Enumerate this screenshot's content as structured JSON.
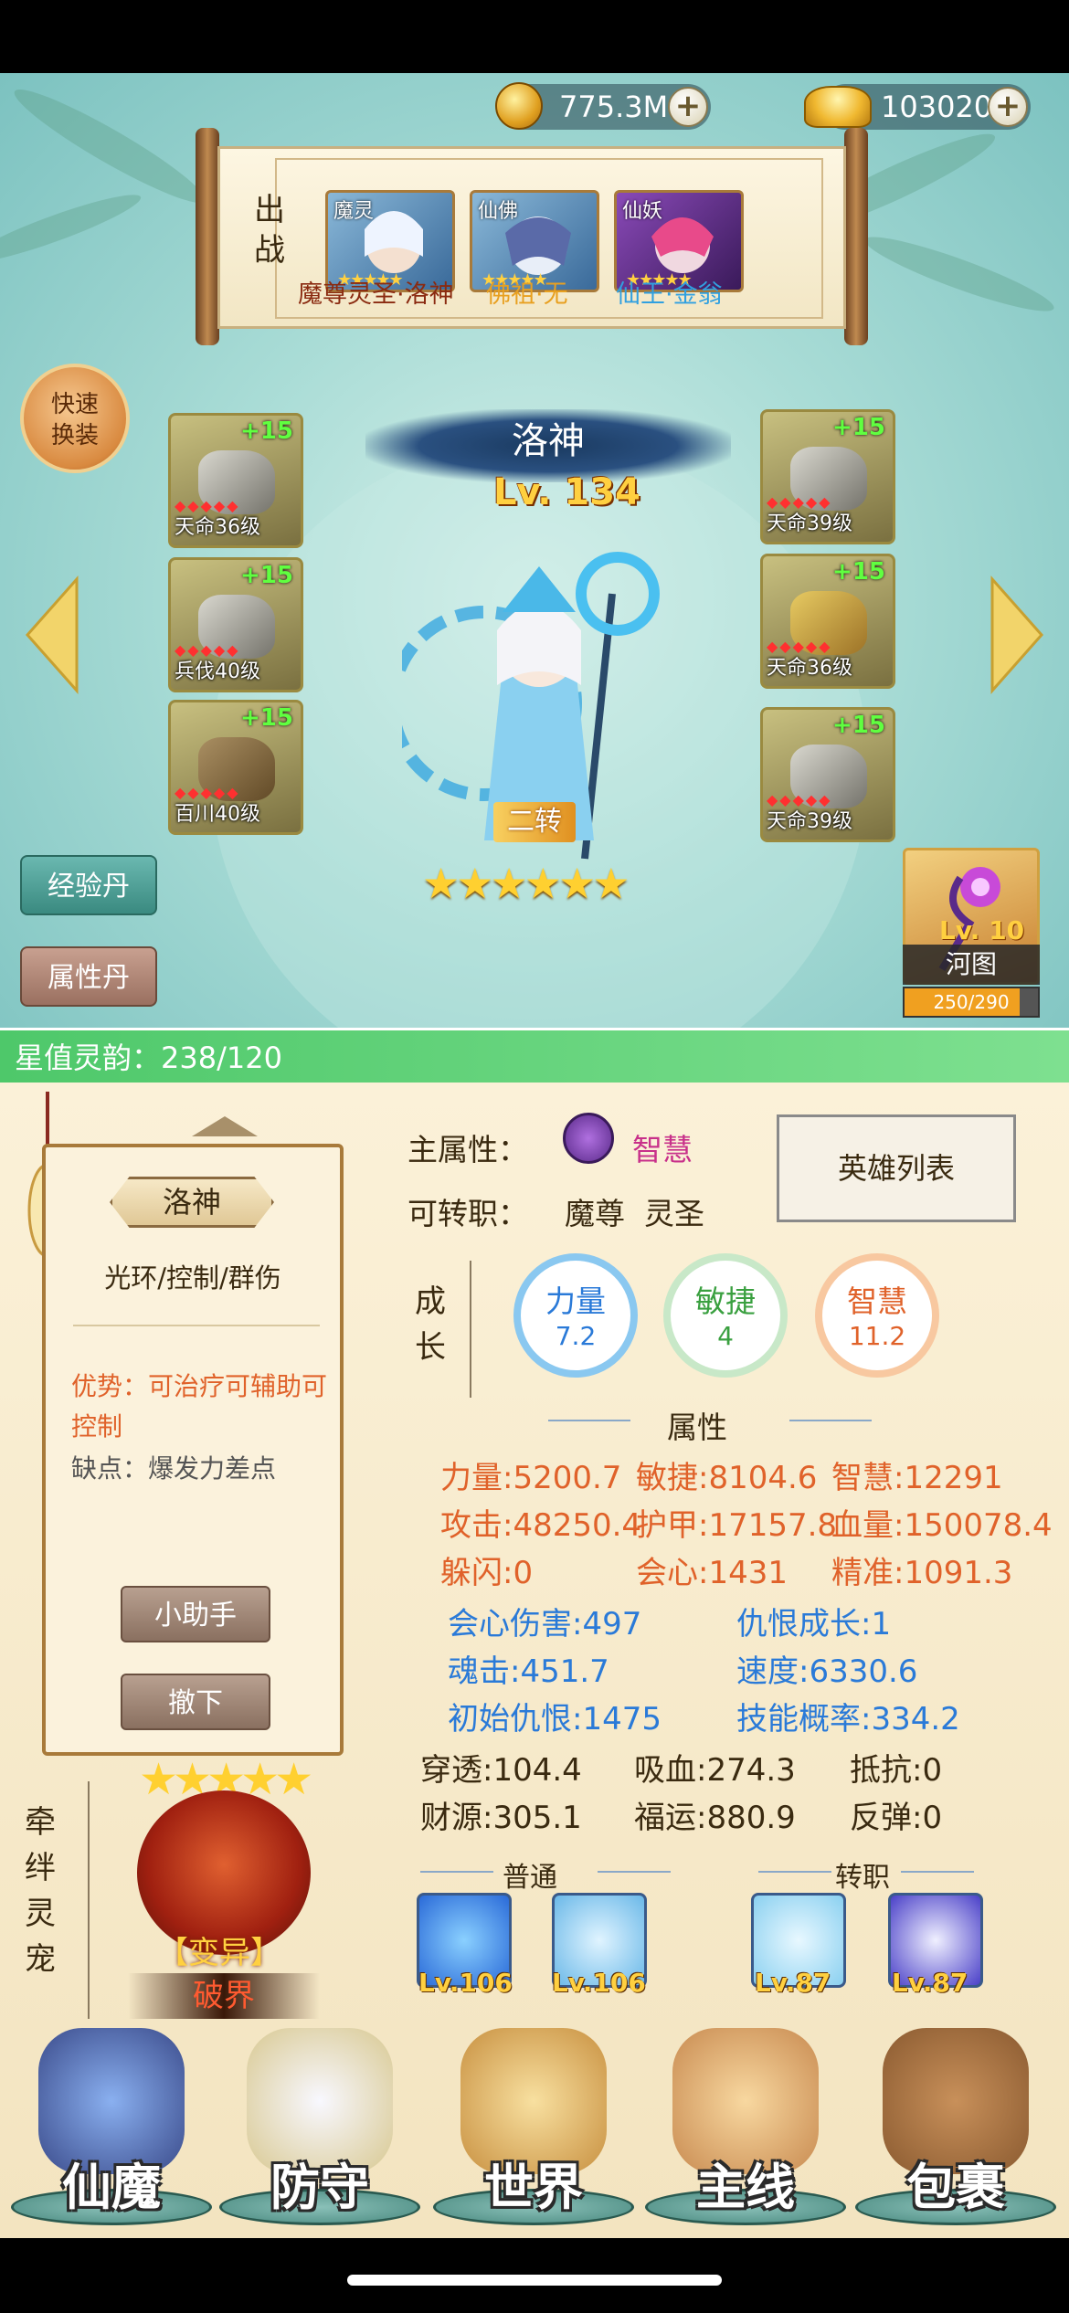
{
  "currency": {
    "coins": "775.3M",
    "ingots": "103020"
  },
  "team": {
    "label": "出战",
    "members": [
      {
        "tag": "魔灵",
        "name": "魔尊灵圣·洛神",
        "color": "#8a2a10",
        "stars": "★★★★★"
      },
      {
        "tag": "仙佛",
        "name": "佛祖·无",
        "color": "#e8a020",
        "stars": "★★★★★"
      },
      {
        "tag": "仙妖",
        "name": "仙王·金翁",
        "color": "#30a0e0",
        "stars": "★★★★★"
      }
    ]
  },
  "quick_swap": [
    "快速",
    "换装"
  ],
  "hero": {
    "name": "洛神",
    "level": "Lv. 134",
    "transfer": "二转",
    "stars": "★★★★★★"
  },
  "equipment_left": [
    {
      "plus": "+15",
      "level": "天命36级"
    },
    {
      "plus": "+15",
      "level": "兵伐40级"
    },
    {
      "plus": "+15",
      "level": "百川40级"
    }
  ],
  "equipment_right": [
    {
      "plus": "+15",
      "level": "天命39级"
    },
    {
      "plus": "+15",
      "level": "天命36级"
    },
    {
      "plus": "+15",
      "level": "天命39级"
    }
  ],
  "buttons": {
    "exp_pill": "经验丹",
    "attr_pill": "属性丹",
    "helper": "小助手",
    "withdraw": "撤下",
    "hero_list": "英雄列表"
  },
  "hetu": {
    "level": "Lv. 10",
    "label": "河图",
    "progress_text": "250/290",
    "progress": 0.862
  },
  "star_bar": "星值灵韵：238/120",
  "panel": {
    "name": "洛神",
    "tags": "光环/控制/群伤",
    "advantage": "优势：可治疗可辅助可控制",
    "disadvantage": "缺点：爆发力差点"
  },
  "main_attr": {
    "label": "主属性：",
    "value": "智慧",
    "job_label": "可转职：",
    "jobs": "魔尊  灵圣"
  },
  "growth": {
    "label": "成长",
    "items": [
      {
        "name": "力量",
        "value": "7.2",
        "color": "#2a7ad8"
      },
      {
        "name": "敏捷",
        "value": "4",
        "color": "#3aa040"
      },
      {
        "name": "智慧",
        "value": "11.2",
        "color": "#e0622a"
      }
    ]
  },
  "attributes": {
    "title": "属性",
    "row1": [
      "力量:5200.7",
      "敏捷:8104.6",
      "智慧:12291"
    ],
    "row2": [
      "攻击:48250.4",
      "护甲:17157.8",
      "血量:150078.4"
    ],
    "row3": [
      "躲闪:0",
      "会心:1431",
      "精准:1091.3"
    ],
    "row4": [
      "会心伤害:497",
      "仇恨成长:1"
    ],
    "row5": [
      "魂击:451.7",
      "速度:6330.6"
    ],
    "row6": [
      "初始仇恨:1475",
      "技能概率:334.2"
    ],
    "row7": [
      "穿透:104.4",
      "吸血:274.3",
      "抵抗:0"
    ],
    "row8": [
      "财源:305.1",
      "福运:880.9",
      "反弹:0"
    ]
  },
  "skills": {
    "normal_label": "普通",
    "transfer_label": "转职",
    "items": [
      {
        "level": "Lv.106",
        "color": "#2a6ad8"
      },
      {
        "level": "Lv.106",
        "color": "#6ab8e8"
      },
      {
        "level": "Lv.87",
        "color": "#8ad0f0"
      },
      {
        "level": "Lv.87",
        "color": "#4a40c8"
      }
    ]
  },
  "pet": {
    "label": "牵绊灵宠",
    "stars": "★★★★★",
    "mutation": "【变异】",
    "state": "破界"
  },
  "nav": [
    {
      "label": "仙魔",
      "icon": "demon-helmet-icon",
      "color": "#3a4a8a"
    },
    {
      "label": "防守",
      "icon": "shield-wing-icon",
      "color": "#d8c890"
    },
    {
      "label": "世界",
      "icon": "world-emblem-icon",
      "color": "#c89040"
    },
    {
      "label": "主线",
      "icon": "quest-scroll-icon",
      "color": "#c88a50"
    },
    {
      "label": "包裹",
      "icon": "treasure-chest-icon",
      "color": "#8a5a30"
    }
  ]
}
